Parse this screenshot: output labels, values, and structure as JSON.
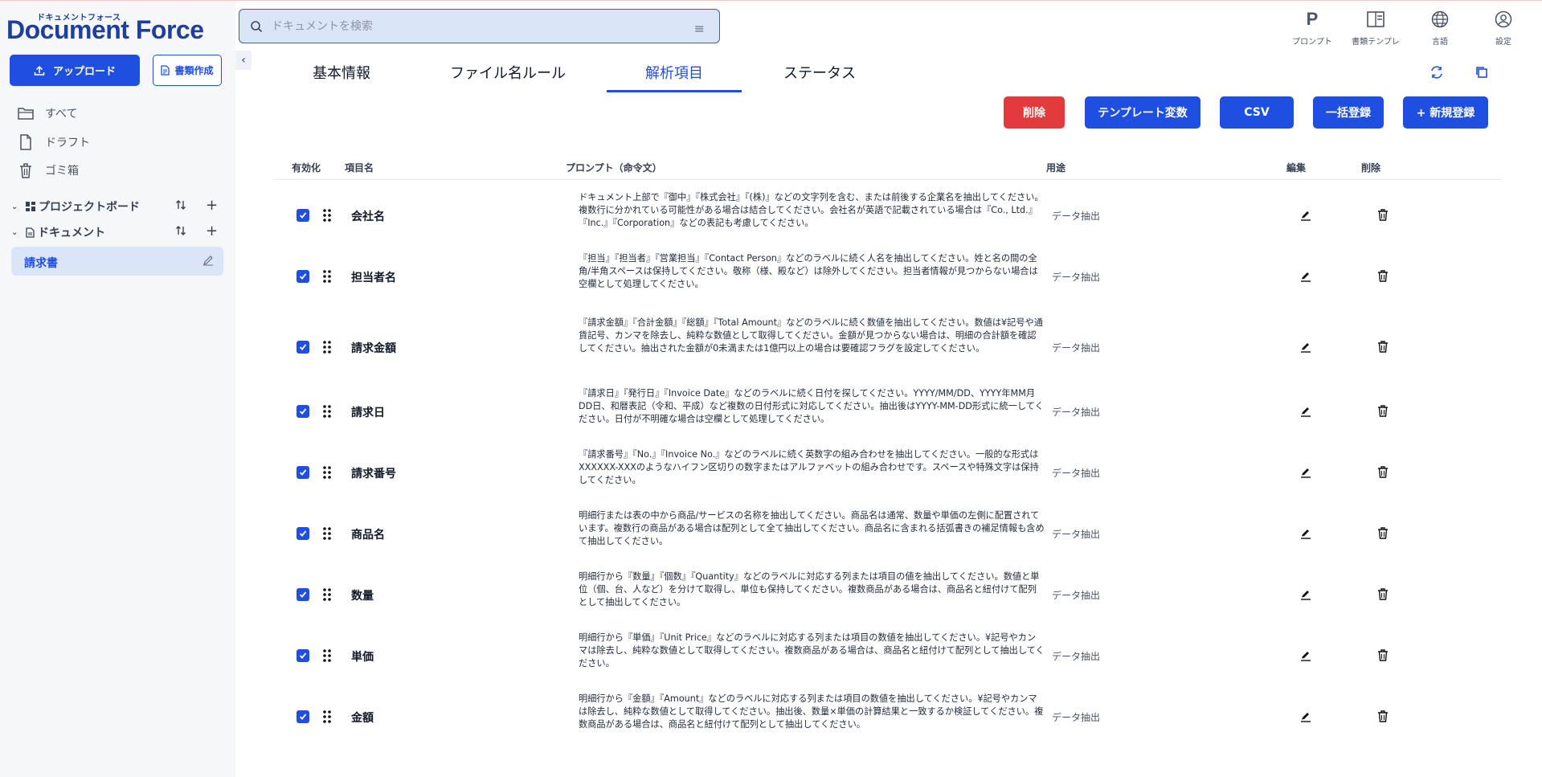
{
  "brand": {
    "ruby": "ドキュメントフォース",
    "name": "Document Force"
  },
  "search": {
    "placeholder": "ドキュメントを検索"
  },
  "sidebar": {
    "upload_label": "アップロード",
    "create_label": "書類作成",
    "nav": [
      {
        "label": "すべて",
        "icon": "folder-icon"
      },
      {
        "label": "ドラフト",
        "icon": "file-icon"
      },
      {
        "label": "ゴミ箱",
        "icon": "trash-icon"
      }
    ],
    "tree": [
      {
        "label": "プロジェクトボード",
        "icon": "dashboard-icon"
      },
      {
        "label": "ドキュメント",
        "icon": "document-icon"
      }
    ],
    "selected_item": "請求書"
  },
  "top_tools": [
    {
      "label": "プロンプト",
      "icon": "prompt-icon"
    },
    {
      "label": "書類テンプレ",
      "icon": "template-icon"
    },
    {
      "label": "言語",
      "icon": "globe-icon"
    },
    {
      "label": "設定",
      "icon": "user-settings-icon"
    }
  ],
  "tabs": [
    {
      "label": "基本情報",
      "active": false
    },
    {
      "label": "ファイル名ルール",
      "active": false
    },
    {
      "label": "解析項目",
      "active": true
    },
    {
      "label": "ステータス",
      "active": false
    }
  ],
  "actions": {
    "delete": "削除",
    "template_vars": "テンプレート変数",
    "csv": "CSV",
    "bulk": "一括登録",
    "new": "+ 新規登録"
  },
  "table": {
    "headers": {
      "enabled": "有効化",
      "name": "項目名",
      "prompt": "プロンプト（命令文）",
      "usage": "用途",
      "edit": "編集",
      "delete": "削除"
    },
    "rows": [
      {
        "name": "会社名",
        "prompt": "ドキュメント上部で『御中』『株式会社』『(株)』などの文字列を含む、または前後する企業名を抽出してください。複数行に分かれている可能性がある場合は結合してください。会社名が英語で記載されている場合は『Co., Ltd.』『Inc.』『Corporation』などの表記も考慮してください。",
        "usage": "データ抽出",
        "enabled": true
      },
      {
        "name": "担当者名",
        "prompt": "『担当』『担当者』『営業担当』『Contact Person』などのラベルに続く人名を抽出してください。姓と名の間の全角/半角スペースは保持してください。敬称（様、殿など）は除外してください。担当者情報が見つからない場合は空欄として処理してください。",
        "usage": "データ抽出",
        "enabled": true
      },
      {
        "name": "請求金額",
        "prompt": "『請求金額』『合計金額』『総額』『Total Amount』などのラベルに続く数値を抽出してください。数値は¥記号や通貨記号、カンマを除去し、純粋な数値として取得してください。金額が見つからない場合は、明細の合計額を確認してください。抽出された金額が0未満または1億円以上の場合は要確認フラグを設定してください。",
        "usage": "データ抽出",
        "enabled": true
      },
      {
        "name": "請求日",
        "prompt": "『請求日』『発行日』『Invoice Date』などのラベルに続く日付を探してください。YYYY/MM/DD、YYYY年MM月DD日、和暦表記（令和、平成）など複数の日付形式に対応してください。抽出後はYYYY-MM-DD形式に統一してください。日付が不明確な場合は空欄として処理してください。",
        "usage": "データ抽出",
        "enabled": true
      },
      {
        "name": "請求番号",
        "prompt": "『請求番号』『No.』『Invoice No.』などのラベルに続く英数字の組み合わせを抽出してください。一般的な形式はXXXXXX-XXXのようなハイフン区切りの数字またはアルファベットの組み合わせです。スペースや特殊文字は保持してください。",
        "usage": "データ抽出",
        "enabled": true
      },
      {
        "name": "商品名",
        "prompt": "明細行または表の中から商品/サービスの名称を抽出してください。商品名は通常、数量や単価の左側に配置されています。複数行の商品がある場合は配列として全て抽出してください。商品名に含まれる括弧書きの補足情報も含めて抽出してください。",
        "usage": "データ抽出",
        "enabled": true
      },
      {
        "name": "数量",
        "prompt": "明細行から『数量』『個数』『Quantity』などのラベルに対応する列または項目の値を抽出してください。数値と単位（個、台、人など）を分けて取得し、単位も保持してください。複数商品がある場合は、商品名と紐付けて配列として抽出してください。",
        "usage": "データ抽出",
        "enabled": true
      },
      {
        "name": "単価",
        "prompt": "明細行から『単価』『Unit Price』などのラベルに対応する列または項目の数値を抽出してください。¥記号やカンマは除去し、純粋な数値として取得してください。複数商品がある場合は、商品名と紐付けて配列として抽出してください。",
        "usage": "データ抽出",
        "enabled": true
      },
      {
        "name": "金額",
        "prompt": "明細行から『金額』『Amount』などのラベルに対応する列または項目の数値を抽出してください。¥記号やカンマは除去し、純粋な数値として取得してください。抽出後、数量×単価の計算結果と一致するか検証してください。複数商品がある場合は、商品名と紐付けて配列として抽出してください。",
        "usage": "データ抽出",
        "enabled": true
      }
    ]
  },
  "colors": {
    "primary": "#1f4fe0",
    "danger": "#e33b3b",
    "sidebar_bg": "#f6f7f9",
    "selected_bg": "#dbe5f8",
    "brand": "#1f3f9e"
  }
}
